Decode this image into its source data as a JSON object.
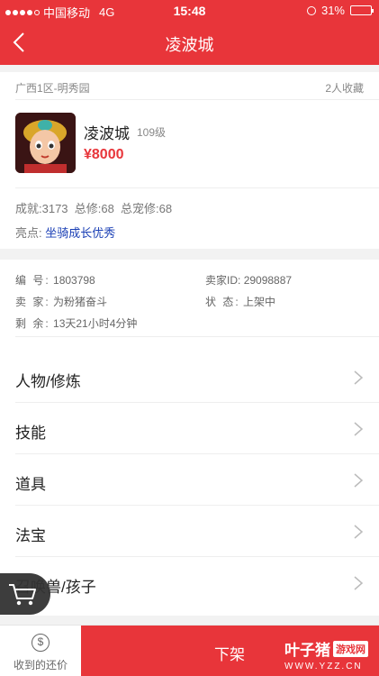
{
  "status_bar": {
    "carrier": "中国移动",
    "network": "4G",
    "time": "15:48",
    "battery": "31%",
    "battery_level": 0.31
  },
  "nav": {
    "title": "凌波城"
  },
  "listing": {
    "server": "广西1区-明秀园",
    "favorites": "2人收藏",
    "name": "凌波城",
    "level": "109级",
    "price": "¥8000",
    "stats": "成就:3173  总修:68  总宠修:68",
    "highlight_label": "亮点:",
    "highlight_value": "坐骑成长优秀"
  },
  "details": {
    "id_label": "编  号:",
    "id_value": "1803798",
    "seller_id_label": "卖家ID:",
    "seller_id_value": "29098887",
    "seller_label": "卖  家:",
    "seller_value": "为粉猪奋斗",
    "state_label": "状  态:",
    "state_value": "上架中",
    "remaining_label": "剩  余:",
    "remaining_value": "13天21小时4分钟"
  },
  "menu": [
    {
      "label": "人物/修炼"
    },
    {
      "label": "技能"
    },
    {
      "label": "道具"
    },
    {
      "label": "法宝"
    },
    {
      "label": "召唤兽/孩子"
    }
  ],
  "bottom": {
    "offer_icon": "$",
    "offer_label": "收到的还价",
    "action_label": "下架",
    "watermark_main": "叶子猪",
    "watermark_tag": "游戏网",
    "watermark_url": "WWW.YZZ.CN"
  },
  "colors": {
    "accent": "#e8353a",
    "highlight": "#1a3fb5"
  }
}
